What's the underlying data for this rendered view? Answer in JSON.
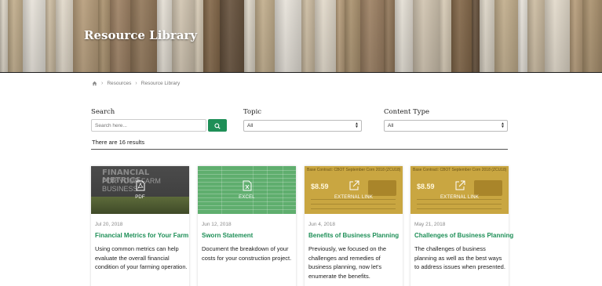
{
  "hero": {
    "title": "Resource Library"
  },
  "breadcrumb": {
    "items": [
      "Resources",
      "Resource Library"
    ]
  },
  "filters": {
    "search": {
      "label": "Search",
      "placeholder": "Search here..."
    },
    "topic": {
      "label": "Topic",
      "selected": "All"
    },
    "content_type": {
      "label": "Content Type",
      "selected": "All"
    }
  },
  "results": {
    "text": "There are 16 results"
  },
  "cards": [
    {
      "type": "PDF",
      "date": "Jul 20, 2018",
      "title": "Financial Metrics for Your Farm",
      "thumb_text_1": "FINANCIAL METRICS",
      "thumb_text_2": "FOR YOUR FARM BUSINESS",
      "desc": "Using common metrics can help evaluate the overall financial condition of your farming operation."
    },
    {
      "type": "EXCEL",
      "date": "Jun 12, 2018",
      "title": "Sworn Statement",
      "desc": "Document the breakdown of your costs for your construction project."
    },
    {
      "type": "EXTERNAL LINK",
      "date": "Jun 4, 2018",
      "title": "Benefits of Business Planning",
      "thumb_header": "Base Contract: CBOT September Corn 2018 (ZCU18)",
      "thumb_price": "$8.59",
      "desc": "Previously, we focused on the challenges and remedies of business planning, now let's enumerate the benefits."
    },
    {
      "type": "EXTERNAL LINK",
      "date": "May 21, 2018",
      "title": "Challenges of Business Planning",
      "thumb_header": "Base Contract: CBOT September Corn 2018 (ZCU18)",
      "thumb_price": "$8.59",
      "desc": "The challenges of business planning as well as the best ways to address issues when presented."
    }
  ],
  "colors": {
    "accent": "#1e8f57",
    "hero_rule": "#1d1d1d",
    "gold_thumb": "#c9a641",
    "excel_thumb": "#5fae6e"
  },
  "icons": {
    "home": "home-icon",
    "search": "search-icon",
    "pdf": "pdf-file-icon",
    "excel": "excel-file-icon",
    "external": "external-link-icon"
  }
}
